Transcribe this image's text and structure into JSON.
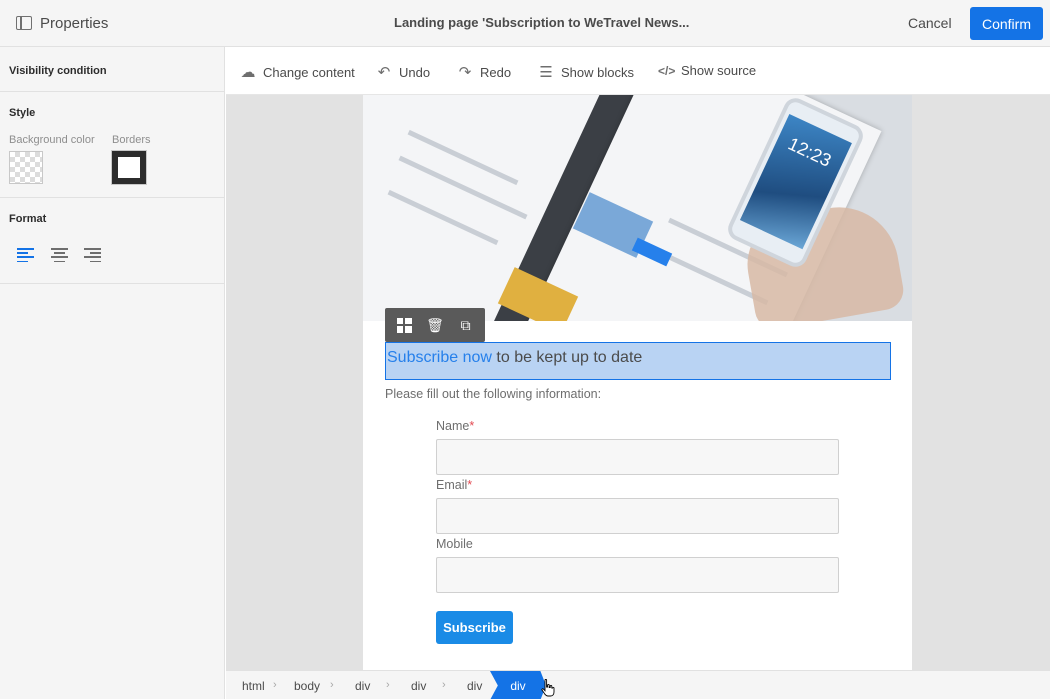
{
  "header": {
    "panel_title": "Properties",
    "document_title": "Landing page 'Subscription to WeTravel News...",
    "cancel_label": "Cancel",
    "confirm_label": "Confirm"
  },
  "left_panel": {
    "visibility_condition": "Visibility condition",
    "style_heading": "Style",
    "background_color_label": "Background color",
    "borders_label": "Borders",
    "format_heading": "Format"
  },
  "toolbar": {
    "change_content": "Change content",
    "undo": "Undo",
    "redo": "Redo",
    "show_blocks": "Show blocks",
    "show_source": "Show source"
  },
  "canvas": {
    "hero_phone_time": "12:23",
    "heading_link": "Subscribe now",
    "heading_rest": " to be kept up to date",
    "intro": "Please fill out the following information:",
    "fields": [
      {
        "label": "Name",
        "required": "*",
        "value": ""
      },
      {
        "label": "Email",
        "required": "*",
        "value": ""
      },
      {
        "label": "Mobile",
        "required": "",
        "value": ""
      }
    ],
    "subscribe_label": "Subscribe"
  },
  "breadcrumb": [
    "html",
    "body",
    "div",
    "div",
    "div",
    "div"
  ],
  "colors": {
    "accent": "#1473e6",
    "selection_fill": "#b9d3f3",
    "required": "#e34850"
  }
}
